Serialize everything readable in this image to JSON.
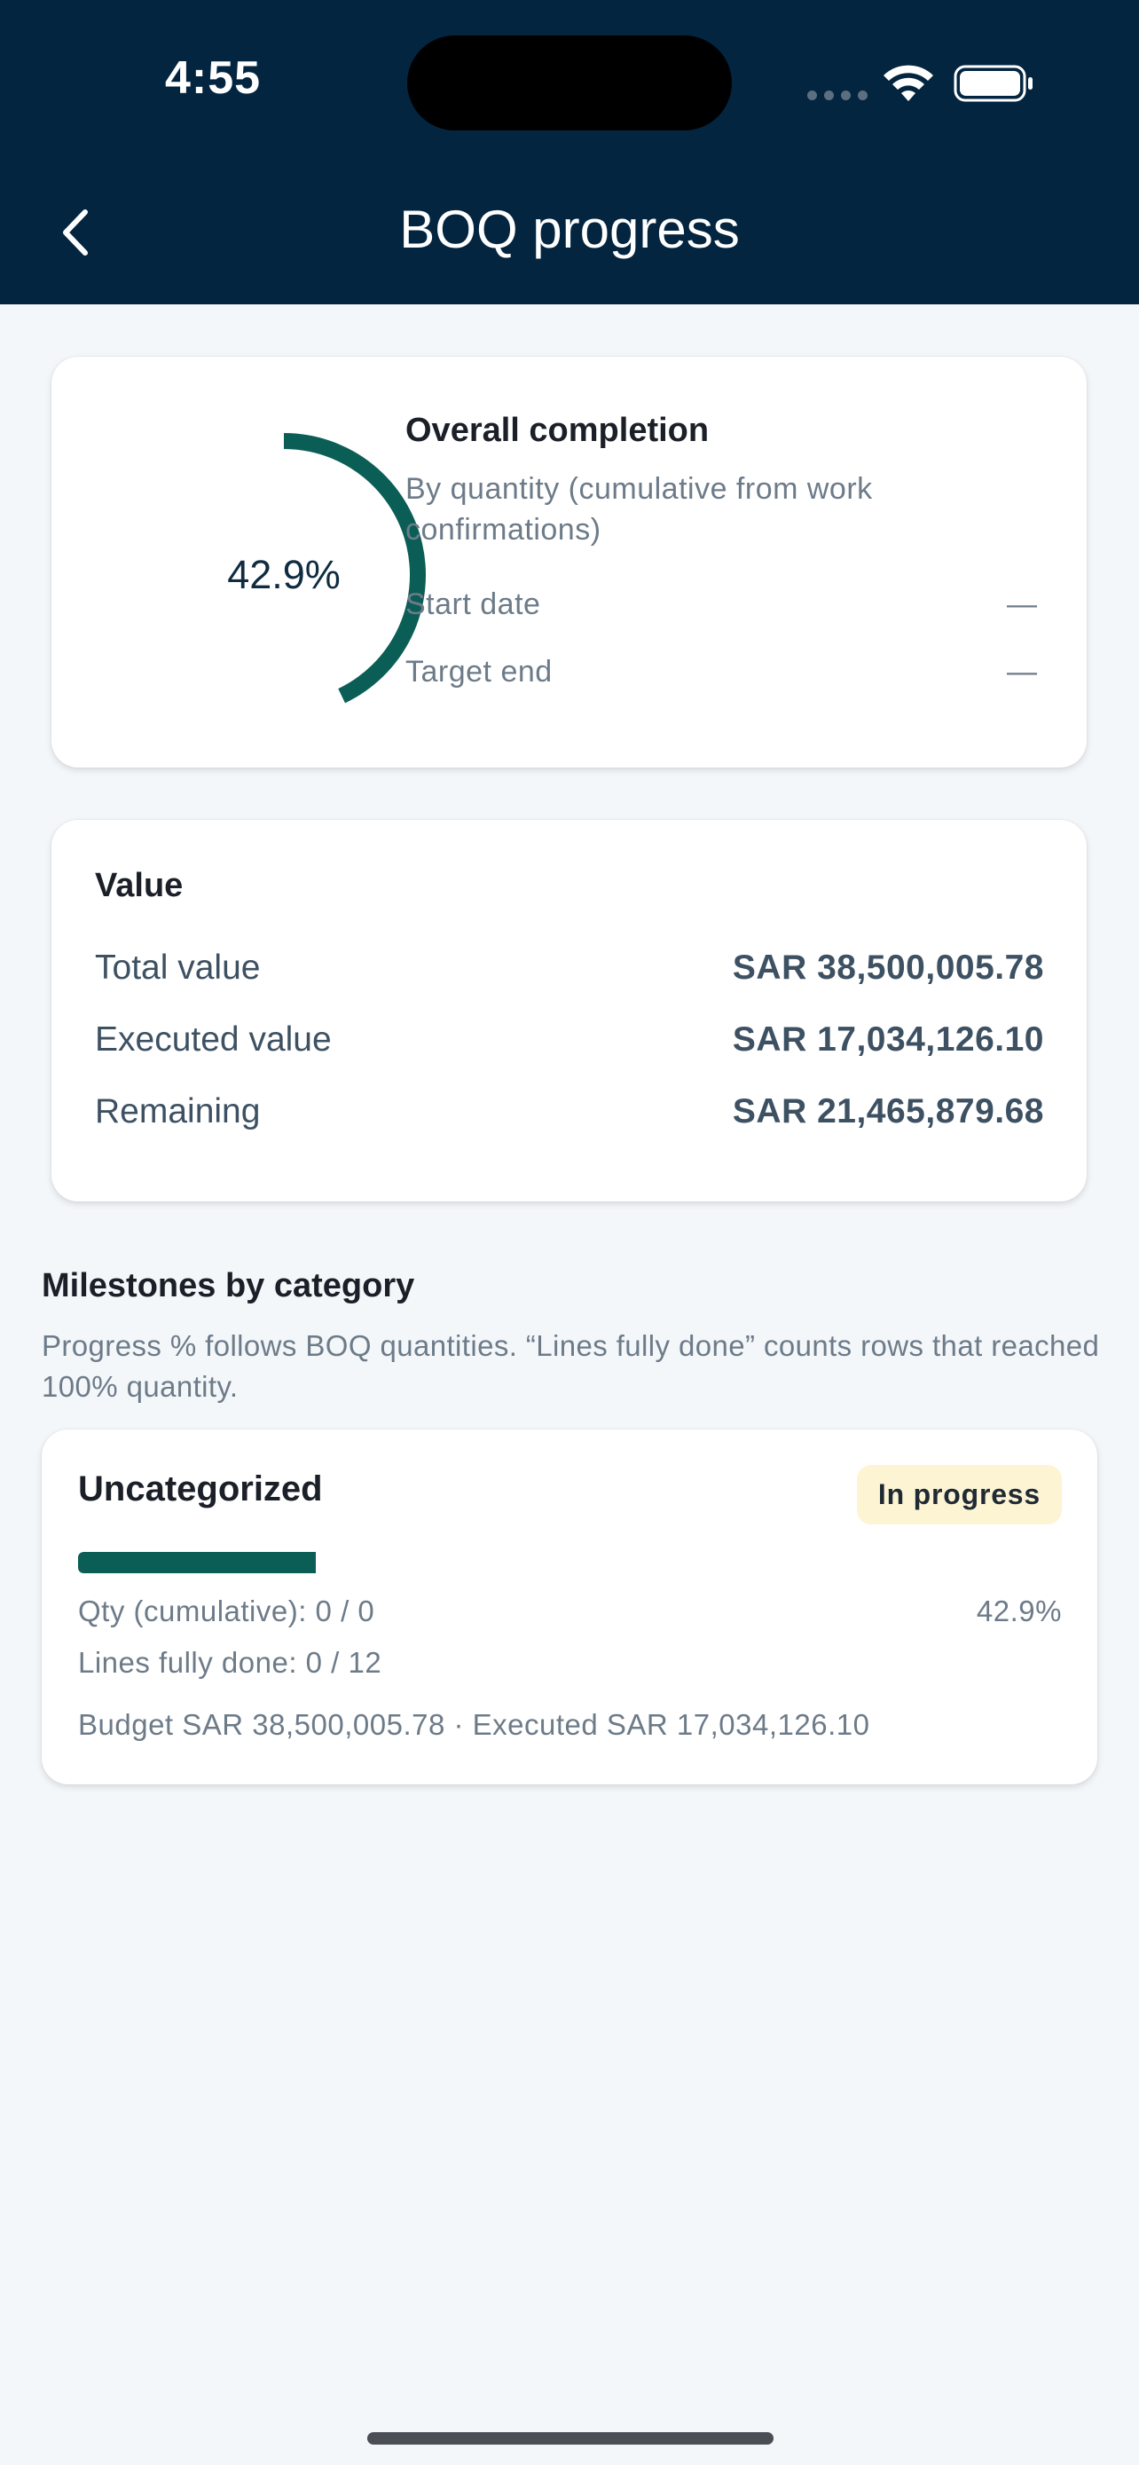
{
  "status_bar": {
    "time": "4:55"
  },
  "header": {
    "title": "BOQ progress",
    "back_icon": "chevron-left-icon",
    "background": "#032540"
  },
  "overall": {
    "percent_label": "42.9%",
    "percent_value": 42.9,
    "title": "Overall completion",
    "subtitle": "By quantity (cumulative from work confirmations)",
    "start_date_label": "Start date",
    "start_date_value": "—",
    "target_end_label": "Target end",
    "target_end_value": "—",
    "ring_color": "#0b5e55"
  },
  "value": {
    "heading": "Value",
    "rows": [
      {
        "label": "Total value",
        "amount": "SAR 38,500,005.78"
      },
      {
        "label": "Executed value",
        "amount": "SAR 17,034,126.10"
      },
      {
        "label": "Remaining",
        "amount": "SAR 21,465,879.68"
      }
    ]
  },
  "milestones": {
    "title": "Milestones by category",
    "description": "Progress % follows BOQ quantities. “Lines fully done” counts rows that reached 100% quantity.",
    "items": [
      {
        "name": "Uncategorized",
        "status": "In progress",
        "progress_fraction": 0.242,
        "qty": "Qty (cumulative): 0 / 0",
        "percent": "42.9%",
        "lines_done": "Lines fully done: 0 / 12",
        "budget": "Budget SAR 38,500,005.78 · Executed SAR 17,034,126.10"
      }
    ]
  },
  "colors": {
    "accent": "#0b5e55",
    "badge_bg": "#fdf4d3",
    "page_bg": "#f4f7fa"
  }
}
